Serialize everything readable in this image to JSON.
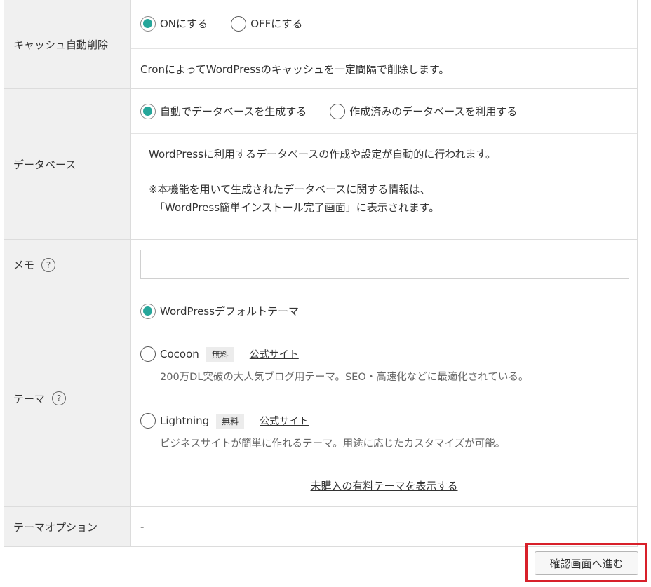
{
  "cache_delete": {
    "label": "キャッシュ自動削除",
    "options": [
      "ONにする",
      "OFFにする"
    ],
    "selected": 0,
    "description": "CronによってWordPressのキャッシュを一定間隔で削除します。"
  },
  "database": {
    "label": "データベース",
    "options": [
      "自動でデータベースを生成する",
      "作成済みのデータベースを利用する"
    ],
    "selected": 0,
    "description": "WordPressに利用するデータベースの作成や設定が自動的に行われます。",
    "note_line1": "※本機能を用いて生成されたデータベースに関する情報は、",
    "note_line2": "「WordPress簡単インストール完了画面」に表示されます。"
  },
  "memo": {
    "label": "メモ",
    "help": "?",
    "value": ""
  },
  "theme": {
    "label": "テーマ",
    "help": "?",
    "default_option": "WordPressデフォルトテーマ",
    "items": [
      {
        "name": "Cocoon",
        "badge": "無料",
        "link": "公式サイト",
        "description": "200万DL突破の大人気ブログ用テーマ。SEO・高速化などに最適化されている。"
      },
      {
        "name": "Lightning",
        "badge": "無料",
        "link": "公式サイト",
        "description": "ビジネスサイトが簡単に作れるテーマ。用途に応じたカスタマイズが可能。"
      }
    ],
    "show_paid_link": "未購入の有料テーマを表示する"
  },
  "theme_option": {
    "label": "テーマオプション",
    "value": "-"
  },
  "submit_label": "確認画面へ進む",
  "colors": {
    "radio_checked": "#26a69a",
    "highlight_border": "#d8202a"
  }
}
